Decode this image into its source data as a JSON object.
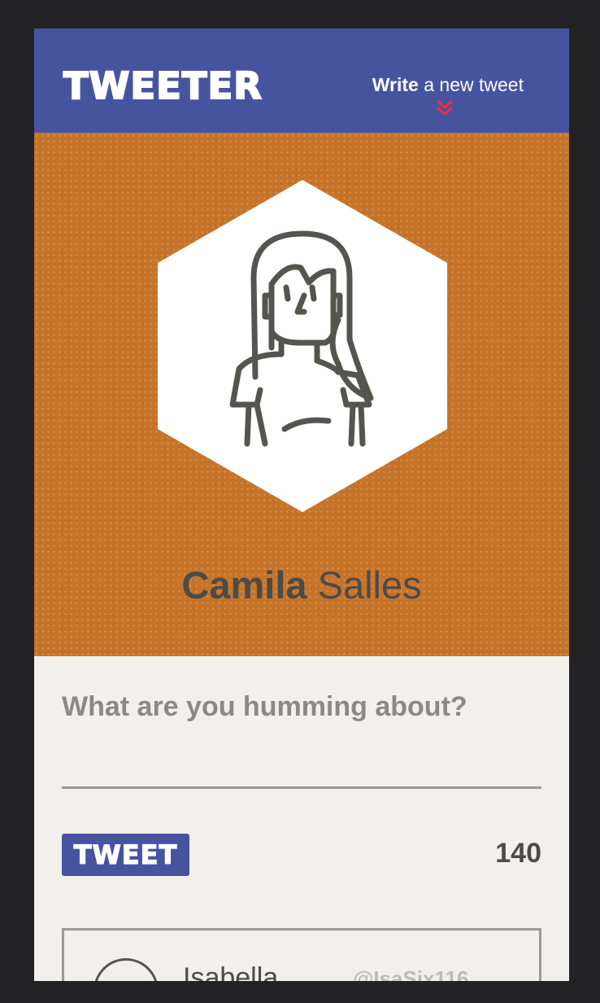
{
  "header": {
    "logo": "TWEETER",
    "write_bold": "Write",
    "write_rest": " a new tweet",
    "chevron_icon": "double-chevron-down",
    "chevron_color": "#e0333a",
    "bar_color": "#4654a0"
  },
  "profile": {
    "first_name": "Camila",
    "last_name": " Salles",
    "avatar_icon": "woman-avatar",
    "background_color": "#c7742b"
  },
  "composer": {
    "placeholder": "What are you humming about?",
    "button_label": "TWEET",
    "char_count": "140"
  },
  "tweets": [
    {
      "name": "Isabella",
      "handle": "@IsaSix116"
    }
  ]
}
